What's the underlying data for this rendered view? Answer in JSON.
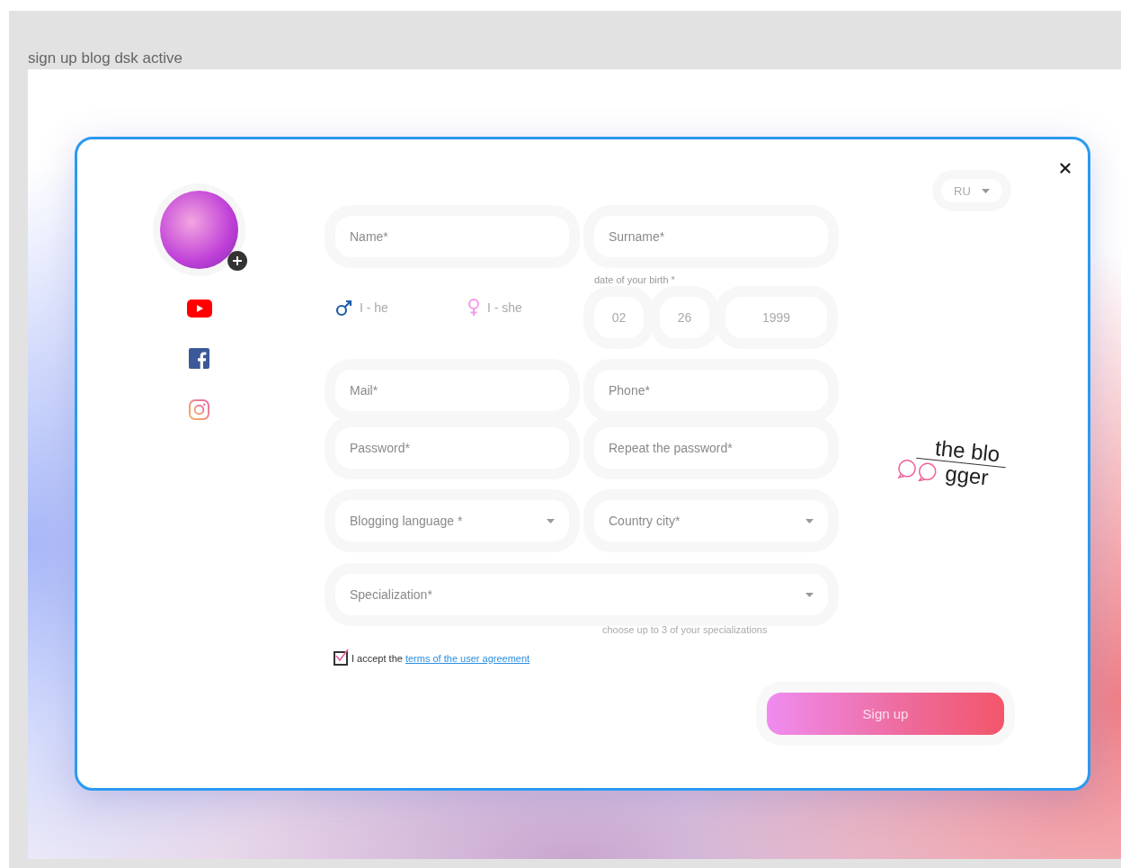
{
  "frame_title": "sign up blog dsk active",
  "language": {
    "value": "RU"
  },
  "name_fields": [
    {
      "placeholder": "Name*"
    },
    {
      "placeholder": "Surname*"
    }
  ],
  "gender": [
    {
      "kind": "male",
      "label": "I - he"
    },
    {
      "kind": "female",
      "label": "I - she"
    }
  ],
  "birth": {
    "label": "date of your birth *",
    "parts": [
      {
        "value": "02"
      },
      {
        "value": "26"
      },
      {
        "value": "1999"
      }
    ]
  },
  "contact_fields": [
    {
      "placeholder": "Mail*"
    },
    {
      "placeholder": "Phone*"
    },
    {
      "placeholder": "Password*"
    },
    {
      "placeholder": "Repeat the password*"
    }
  ],
  "selects": [
    {
      "placeholder": "Blogging language *"
    },
    {
      "placeholder": "Country city*"
    }
  ],
  "specialization": {
    "placeholder": "Specialization*",
    "hint": "choose up to 3 of your specializations"
  },
  "agreement": {
    "checked": true,
    "text": "I accept the",
    "link": "terms of the user agreement"
  },
  "submit": "Sign up",
  "logo": {
    "line1": "the blo",
    "line2": "gger"
  }
}
